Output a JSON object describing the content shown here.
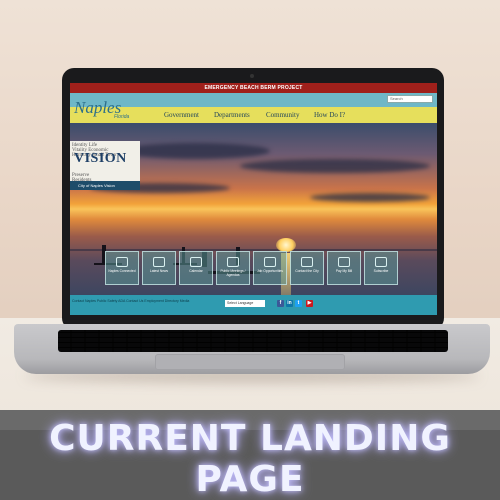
{
  "site": {
    "emergency_banner": "EMERGENCY BEACH BERM PROJECT",
    "search_placeholder": "Search",
    "logo": "Naples",
    "logo_sub": "Florida",
    "nav": [
      "Government",
      "Departments",
      "Community",
      "How Do I?"
    ],
    "vision": {
      "words": [
        "Identity",
        "Life",
        "Vitality",
        "Economic",
        "Harmony",
        "Small Town",
        "Preserve",
        "Residents"
      ],
      "title": "VISION",
      "link": "City of Naples Vision"
    },
    "tiles": [
      {
        "label": "Naples Connected",
        "icon": "grid-icon"
      },
      {
        "label": "Latest News",
        "icon": "news-icon"
      },
      {
        "label": "Calendar",
        "icon": "calendar-icon"
      },
      {
        "label": "Public Meetings / Agendas",
        "icon": "meetings-icon"
      },
      {
        "label": "Job Opportunities",
        "icon": "jobs-icon"
      },
      {
        "label": "Contact the City",
        "icon": "monitor-icon"
      },
      {
        "label": "Pay My Bill",
        "icon": "bill-icon"
      },
      {
        "label": "Subscribe",
        "icon": "mail-icon"
      }
    ],
    "footer_links": "Contact Naples Public Safety   ADA   Contact Us   Employment Directory   Media",
    "translate_label": "Select Language",
    "social": [
      {
        "name": "facebook",
        "glyph": "f",
        "color": "#3b5998"
      },
      {
        "name": "linkedin",
        "glyph": "in",
        "color": "#0e76a8"
      },
      {
        "name": "twitter",
        "glyph": "t",
        "color": "#1da1f2"
      },
      {
        "name": "youtube",
        "glyph": "▶",
        "color": "#cc181e"
      }
    ]
  },
  "caption": "CURRENT LANDING PAGE"
}
